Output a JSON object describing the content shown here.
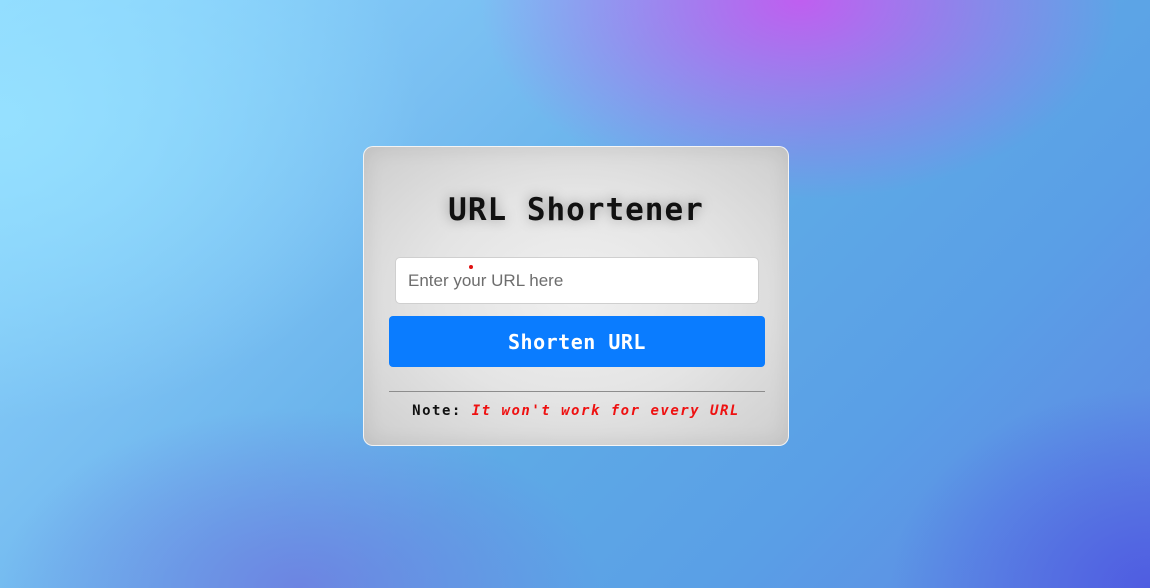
{
  "card": {
    "title": "URL Shortener",
    "input": {
      "value": "",
      "placeholder": "Enter your URL here"
    },
    "shorten_button_label": "Shorten URL",
    "note": {
      "label": "Note:",
      "text": "It won't work for every URL"
    }
  },
  "colors": {
    "button": "#0a7cff",
    "note_text": "#ee1111",
    "title": "#111111"
  }
}
